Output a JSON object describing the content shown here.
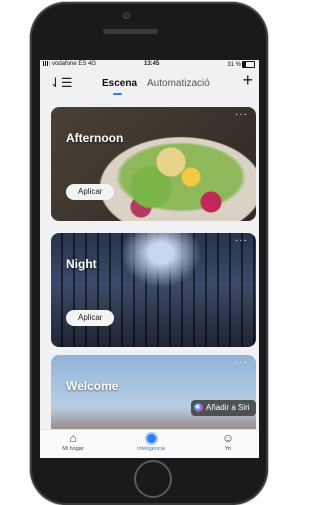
{
  "status": {
    "carrier": "vodafone ES  4G",
    "time": "13:45",
    "battery": "31 %"
  },
  "header": {
    "tab_scene": "Escena",
    "tab_auto": "Automatizació",
    "accent": "#2f7cf6"
  },
  "scenes": [
    {
      "title": "Afternoon",
      "apply": "Aplicar"
    },
    {
      "title": "Night",
      "apply": "Aplicar"
    },
    {
      "title": "Welcome",
      "siri": "Añadir a Siri"
    }
  ],
  "more": "···",
  "tabbar": {
    "home": "Mi hogar",
    "intelligence": "Inteligencia",
    "me": "Yo"
  }
}
